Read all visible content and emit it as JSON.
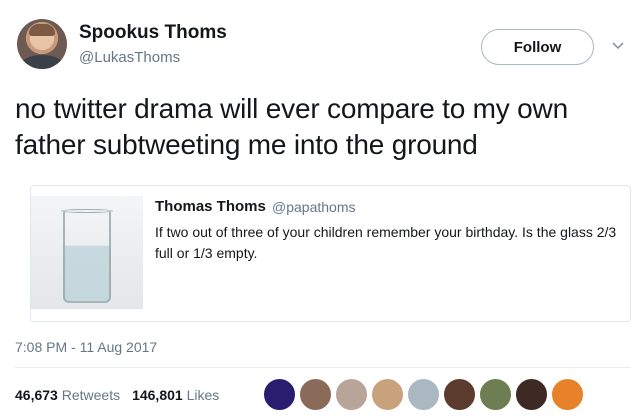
{
  "author": {
    "display_name": "Spookus Thoms",
    "handle": "@LukasThoms"
  },
  "follow_label": "Follow",
  "tweet": {
    "text": "no twitter drama will ever compare to my own father subtweeting me into the ground"
  },
  "quoted_tweet": {
    "display_name": "Thomas Thoms",
    "handle": "@papathoms",
    "text": "If two out of three of your children remember your birthday. Is the glass 2/3 full or 1/3 empty."
  },
  "timestamp": "7:08 PM - 11 Aug 2017",
  "stats": {
    "retweets_count": "46,673",
    "retweets_label": "Retweets",
    "likes_count": "146,801",
    "likes_label": "Likes"
  },
  "likers": [
    {
      "color": "#2a1c6e"
    },
    {
      "color": "#8a6b5a"
    },
    {
      "color": "#b9a49a"
    },
    {
      "color": "#c7a27c"
    },
    {
      "color": "#aab8c2"
    },
    {
      "color": "#5b3b2e"
    },
    {
      "color": "#6e7d52"
    },
    {
      "color": "#3d2a24"
    },
    {
      "color": "#e8822a"
    }
  ]
}
